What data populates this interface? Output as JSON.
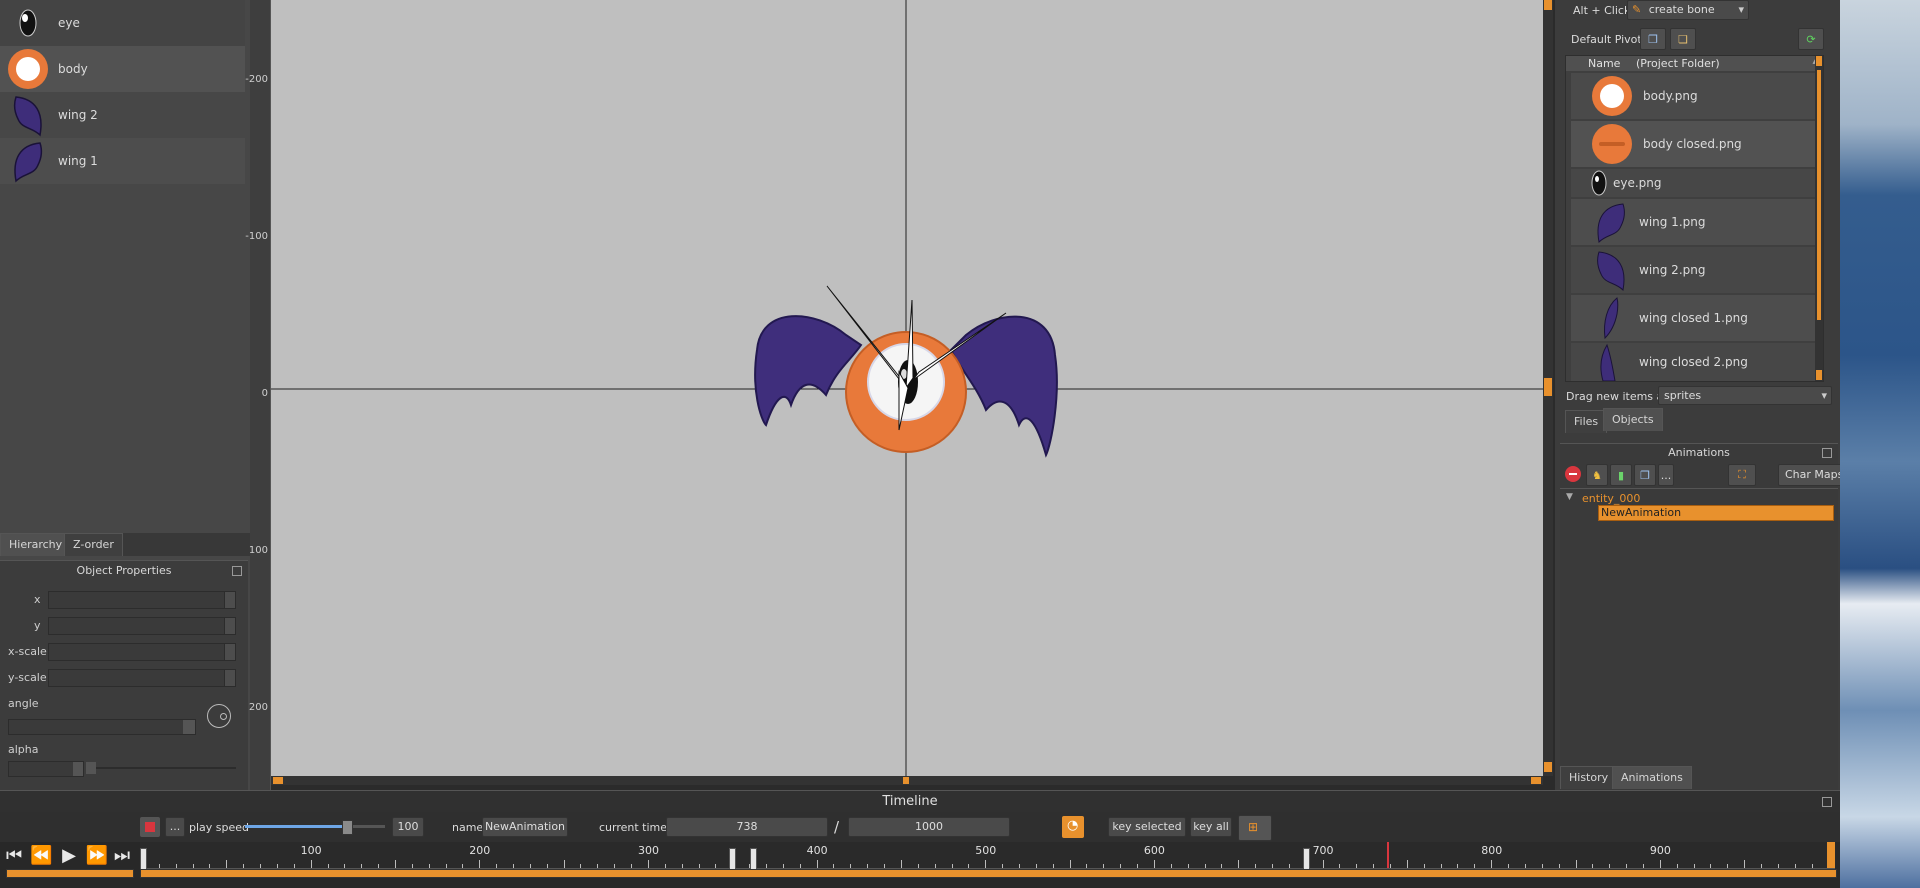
{
  "hierarchy": {
    "items": [
      {
        "label": "eye",
        "icon": "eye-sprite-icon"
      },
      {
        "label": "body",
        "icon": "body-sprite-icon"
      },
      {
        "label": "wing 2",
        "icon": "wing-sprite-icon"
      },
      {
        "label": "wing 1",
        "icon": "wing-sprite-icon"
      }
    ],
    "tabs": [
      "Hierarchy",
      "Z-order"
    ]
  },
  "object_properties": {
    "title": "Object Properties",
    "fields": [
      "x",
      "y",
      "x-scale",
      "y-scale"
    ],
    "angle_label": "angle",
    "alpha_label": "alpha"
  },
  "ruler": {
    "ticks": [
      "-200",
      "-100",
      "0",
      "100",
      "200"
    ]
  },
  "toolbar": {
    "alt_click_label": "Alt + Click:",
    "alt_click_value": "create bone",
    "default_pivot_label": "Default Pivot:"
  },
  "files": {
    "header_name": "Name",
    "header_folder": "(Project Folder)",
    "items": [
      {
        "label": "body.png"
      },
      {
        "label": "body closed.png"
      },
      {
        "label": "eye.png"
      },
      {
        "label": "wing 1.png"
      },
      {
        "label": "wing 2.png"
      },
      {
        "label": "wing closed 1.png"
      },
      {
        "label": "wing closed 2.png"
      }
    ],
    "drag_label": "Drag new items as",
    "drag_value": "sprites",
    "tabs": [
      "Files",
      "Objects"
    ]
  },
  "animations": {
    "title": "Animations",
    "char_maps_label": "Char Maps",
    "more_label": "...",
    "entity": "entity_000",
    "animation": "NewAnimation",
    "tabs": [
      "History",
      "Animations"
    ]
  },
  "timeline": {
    "title": "Timeline",
    "more_label": "...",
    "play_speed_label": "play speed",
    "play_speed_value": "100",
    "play_speed_fraction": 0.73,
    "name_label": "name",
    "name_value": "NewAnimation",
    "current_time_label": "current time:",
    "current_time": "738",
    "separator": "/",
    "length": "1000",
    "key_selected_label": "key selected",
    "key_all_label": "key all",
    "ticks": [
      "100",
      "200",
      "300",
      "400",
      "500",
      "600",
      "700",
      "800",
      "900"
    ],
    "keyframes": [
      350,
      362,
      690
    ],
    "playhead": 738,
    "accent_color": "#e8912d"
  }
}
